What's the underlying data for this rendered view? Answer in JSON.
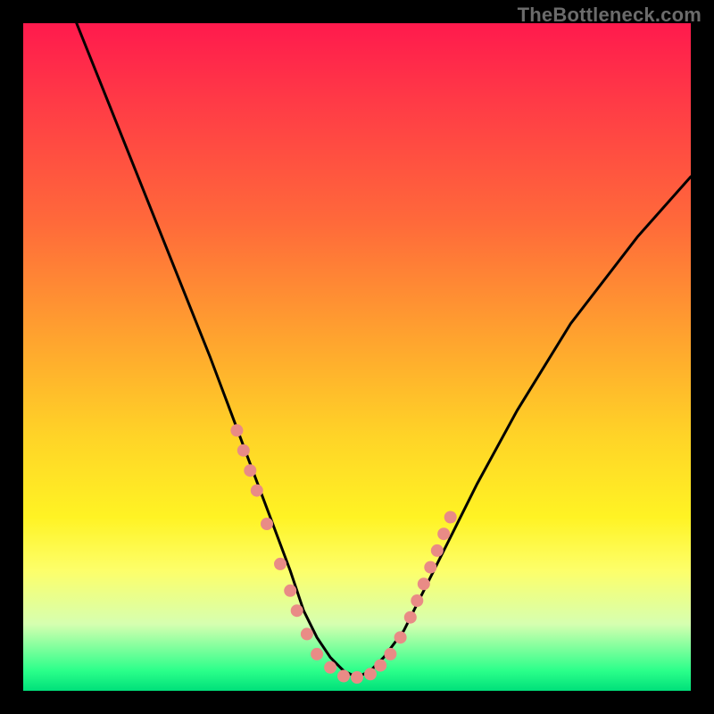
{
  "watermark": "TheBottleneck.com",
  "chart_data": {
    "type": "line",
    "title": "",
    "xlabel": "",
    "ylabel": "",
    "xlim": [
      0,
      100
    ],
    "ylim": [
      0,
      100
    ],
    "grid": false,
    "series": [
      {
        "name": "curve",
        "color": "#000000",
        "x": [
          8,
          12,
          16,
          20,
          24,
          28,
          31,
          34,
          37,
          40,
          42,
          44,
          46,
          48,
          50,
          52,
          54,
          57,
          60,
          64,
          68,
          74,
          82,
          92,
          100
        ],
        "values": [
          100,
          90,
          80,
          70,
          60,
          50,
          42,
          34,
          26,
          18,
          12,
          8,
          5,
          3,
          2,
          3,
          5,
          9,
          15,
          23,
          31,
          42,
          55,
          68,
          77
        ]
      }
    ],
    "markers": {
      "name": "dots",
      "color": "#e98b86",
      "radius_px": 7,
      "points_xy": [
        [
          32,
          39
        ],
        [
          33,
          36
        ],
        [
          34,
          33
        ],
        [
          35,
          30
        ],
        [
          36.5,
          25
        ],
        [
          38.5,
          19
        ],
        [
          40,
          15
        ],
        [
          41,
          12
        ],
        [
          42.5,
          8.5
        ],
        [
          44,
          5.5
        ],
        [
          46,
          3.5
        ],
        [
          48,
          2.2
        ],
        [
          50,
          2
        ],
        [
          52,
          2.5
        ],
        [
          53.5,
          3.8
        ],
        [
          55,
          5.5
        ],
        [
          56.5,
          8
        ],
        [
          58,
          11
        ],
        [
          59,
          13.5
        ],
        [
          60,
          16
        ],
        [
          61,
          18.5
        ],
        [
          62,
          21
        ],
        [
          63,
          23.5
        ],
        [
          64,
          26
        ]
      ]
    }
  }
}
